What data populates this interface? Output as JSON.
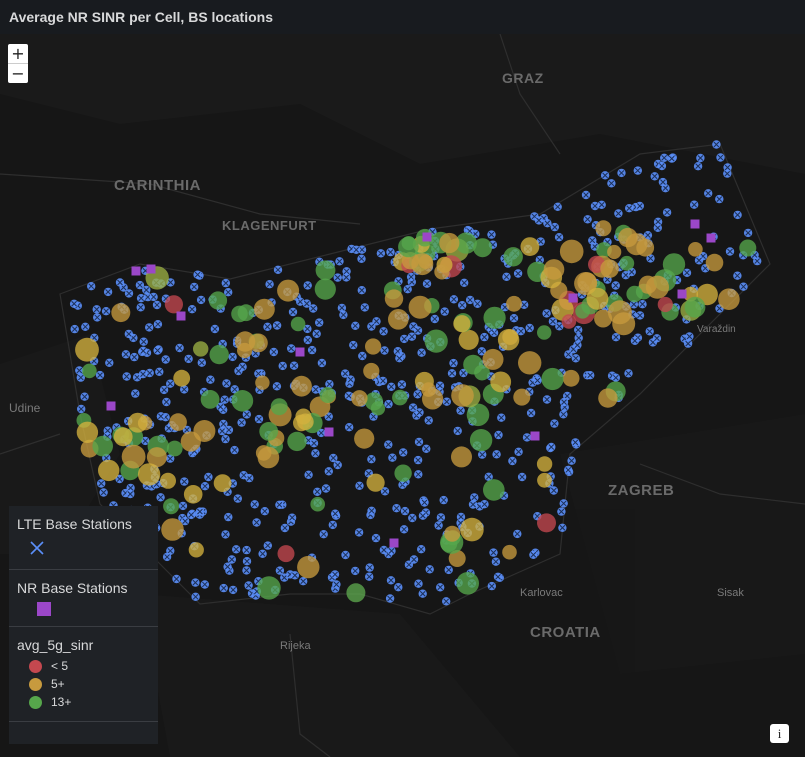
{
  "panel": {
    "title": "Average NR SINR per Cell, BS locations"
  },
  "zoom": {
    "in": "+",
    "out": "−"
  },
  "map_labels": {
    "regions": [
      "GRAZ",
      "CARINTHIA",
      "KLAGENFURT",
      "ZAGREB",
      "CROATIA"
    ],
    "cities": [
      "Udine",
      "Varaždin",
      "Karlovac",
      "Sisak",
      "Rijeka"
    ]
  },
  "legend": {
    "lte": {
      "title": "LTE Base Stations",
      "color": "#5b8ff9",
      "icon": "x-icon"
    },
    "nr": {
      "title": "NR Base Stations",
      "color": "#9b47c8",
      "icon": "square-icon"
    },
    "sinr": {
      "title": "avg_5g_sinr",
      "items": [
        {
          "label": "< 5",
          "color": "#c4484f"
        },
        {
          "label": "5+",
          "color": "#c79a3e"
        },
        {
          "label": "13+",
          "color": "#56a64b"
        }
      ]
    }
  },
  "info": {
    "label": "i"
  }
}
